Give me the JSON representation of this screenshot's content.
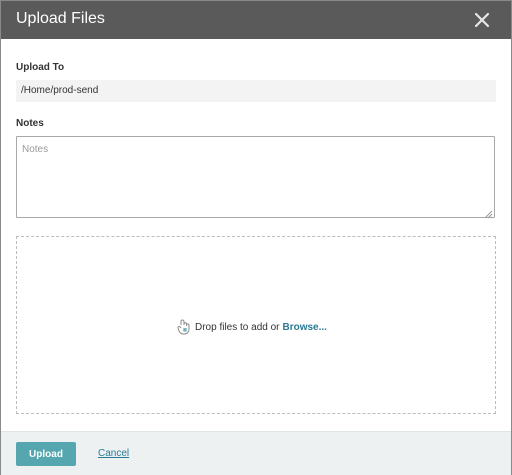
{
  "dialog": {
    "title": "Upload Files",
    "close_icon": "close-icon"
  },
  "upload_to": {
    "label": "Upload To",
    "value": "/Home/prod-send"
  },
  "notes": {
    "label": "Notes",
    "placeholder": "Notes",
    "value": ""
  },
  "dropzone": {
    "icon": "upload-drop-icon",
    "text": "Drop files to add or",
    "browse_label": "Browse..."
  },
  "footer": {
    "upload_label": "Upload",
    "cancel_label": "Cancel"
  },
  "colors": {
    "titlebar": "#5a5a5a",
    "accent": "#55a6ae",
    "link": "#2a7a94",
    "footer_bg": "#edf1f2"
  }
}
